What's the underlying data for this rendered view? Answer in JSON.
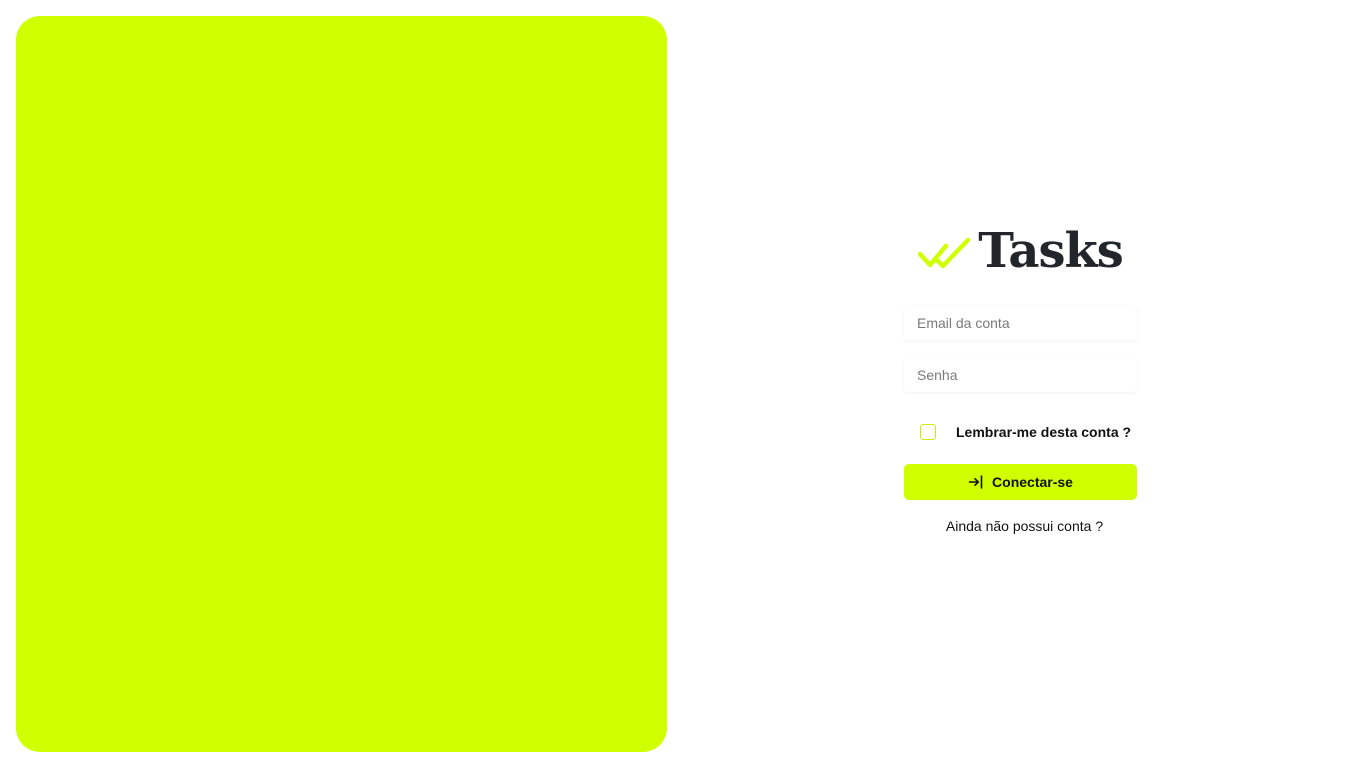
{
  "brand": {
    "name": "Tasks",
    "icon": "double-check-icon",
    "accent_color": "#d0ff00",
    "text_color": "#22262b"
  },
  "hero": {
    "color": "#d0ff00"
  },
  "form": {
    "email_placeholder": "Email da conta",
    "email_value": "",
    "password_placeholder": "Senha",
    "password_value": "",
    "remember_label": "Lembrar-me desta conta ?",
    "remember_checked": false,
    "submit_label": "Conectar-se",
    "submit_icon": "login-icon",
    "signup_link": "Ainda não possui conta ?"
  }
}
